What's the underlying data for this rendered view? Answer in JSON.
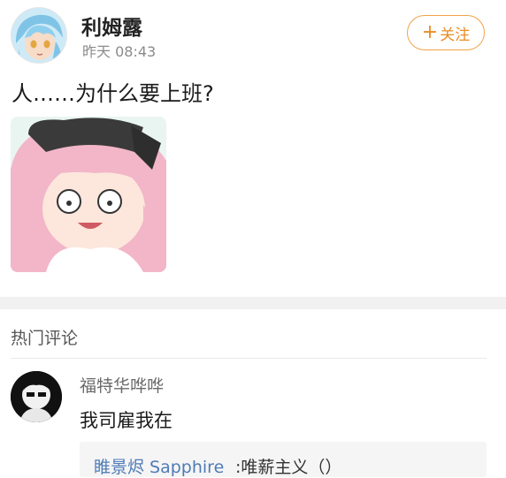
{
  "post": {
    "username": "利姆露",
    "time": "昨天 08:43",
    "follow_label": "关注",
    "follow_icon": "plus-icon",
    "text": "人……为什么要上班?",
    "image_icon": "anime-girl-image"
  },
  "comments": {
    "section_title": "热门评论",
    "items": [
      {
        "author": "福特华哗哗",
        "text": "我司雇我在",
        "reply": {
          "author": "睢景烬 Sapphire",
          "text": ":唯薪主义（）"
        }
      }
    ]
  },
  "colors": {
    "accent": "#e98c25",
    "link": "#4f7bb6",
    "band": "#f1f1f1"
  }
}
